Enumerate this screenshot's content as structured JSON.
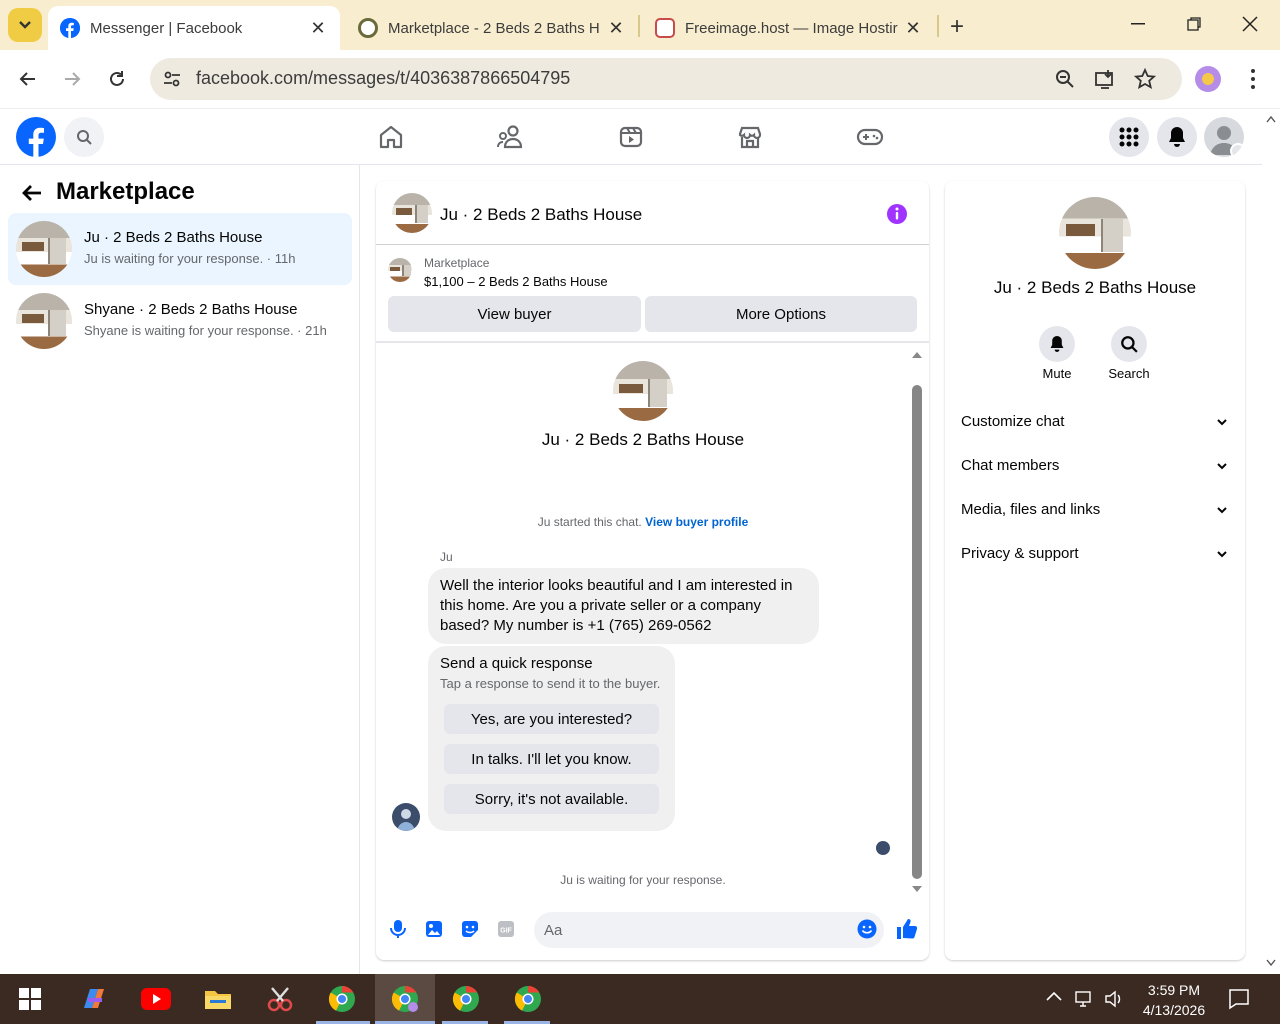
{
  "browser": {
    "tabs": [
      {
        "title": "Messenger | Facebook",
        "active": true,
        "icon": "facebook-icon"
      },
      {
        "title": "Marketplace - 2 Beds 2 Baths H",
        "active": false,
        "icon": "marketplace-favicon"
      },
      {
        "title": "Freeimage.host — Image Hostir",
        "active": false,
        "icon": "freeimage-favicon"
      }
    ],
    "url": "facebook.com/messages/t/4036387866504795"
  },
  "sidebar": {
    "title": "Marketplace",
    "conversations": [
      {
        "name": "Ju · 2 Beds 2 Baths House",
        "preview": "Ju is waiting for your response. · 11h",
        "selected": true
      },
      {
        "name": "Shyane · 2 Beds 2 Baths House",
        "preview": "Shyane is waiting for your response. · 21h",
        "selected": false
      }
    ]
  },
  "chat": {
    "title": "Ju · 2 Beds 2 Baths House",
    "listing_source": "Marketplace",
    "listing_price": "$1,100 – 2 Beds 2 Baths House",
    "view_buyer": "View buyer",
    "more_options": "More Options",
    "intro_name": "Ju · 2 Beds 2 Baths House",
    "started_text": "Ju started this chat.",
    "started_link": "View buyer profile",
    "sender": "Ju",
    "message": "Well the interior looks beautiful and I am interested in this home. Are you a private seller or a company based? My number is +1 (765) 269-0562",
    "quick_title": "Send a quick response",
    "quick_sub": "Tap a response to send it to the buyer.",
    "quick_responses": [
      "Yes, are you interested?",
      "In talks. I'll let you know.",
      "Sorry, it's not available."
    ],
    "waiting": "Ju is waiting for your response.",
    "input_placeholder": "Aa"
  },
  "details": {
    "name": "Ju · 2 Beds 2 Baths House",
    "actions": [
      {
        "label": "Mute",
        "icon": "bell-icon"
      },
      {
        "label": "Search",
        "icon": "search-icon"
      }
    ],
    "sections": [
      "Customize chat",
      "Chat members",
      "Media, files and links",
      "Privacy & support"
    ]
  },
  "taskbar": {
    "time": "3:59 PM",
    "date": "4/13/2026"
  },
  "colors": {
    "accent": "#0866ff",
    "info_purple": "#a033ff",
    "selected_row": "#ebf5ff",
    "tab_strip": "#f8eecf"
  }
}
